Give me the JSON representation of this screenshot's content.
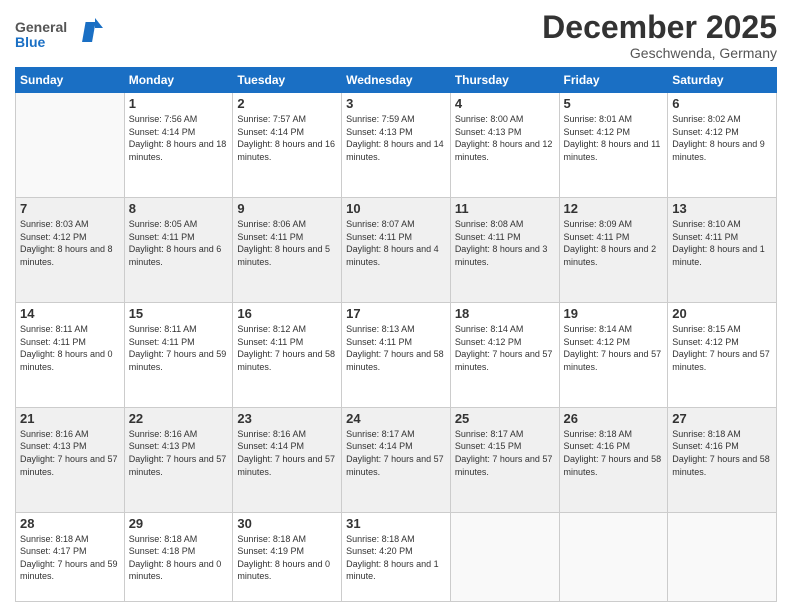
{
  "logo": {
    "text_general": "General",
    "text_blue": "Blue"
  },
  "title": "December 2025",
  "location": "Geschwenda, Germany",
  "weekdays": [
    "Sunday",
    "Monday",
    "Tuesday",
    "Wednesday",
    "Thursday",
    "Friday",
    "Saturday"
  ],
  "weeks": [
    [
      {
        "day": "",
        "sunrise": "",
        "sunset": "",
        "daylight": ""
      },
      {
        "day": "1",
        "sunrise": "Sunrise: 7:56 AM",
        "sunset": "Sunset: 4:14 PM",
        "daylight": "Daylight: 8 hours and 18 minutes."
      },
      {
        "day": "2",
        "sunrise": "Sunrise: 7:57 AM",
        "sunset": "Sunset: 4:14 PM",
        "daylight": "Daylight: 8 hours and 16 minutes."
      },
      {
        "day": "3",
        "sunrise": "Sunrise: 7:59 AM",
        "sunset": "Sunset: 4:13 PM",
        "daylight": "Daylight: 8 hours and 14 minutes."
      },
      {
        "day": "4",
        "sunrise": "Sunrise: 8:00 AM",
        "sunset": "Sunset: 4:13 PM",
        "daylight": "Daylight: 8 hours and 12 minutes."
      },
      {
        "day": "5",
        "sunrise": "Sunrise: 8:01 AM",
        "sunset": "Sunset: 4:12 PM",
        "daylight": "Daylight: 8 hours and 11 minutes."
      },
      {
        "day": "6",
        "sunrise": "Sunrise: 8:02 AM",
        "sunset": "Sunset: 4:12 PM",
        "daylight": "Daylight: 8 hours and 9 minutes."
      }
    ],
    [
      {
        "day": "7",
        "sunrise": "Sunrise: 8:03 AM",
        "sunset": "Sunset: 4:12 PM",
        "daylight": "Daylight: 8 hours and 8 minutes."
      },
      {
        "day": "8",
        "sunrise": "Sunrise: 8:05 AM",
        "sunset": "Sunset: 4:11 PM",
        "daylight": "Daylight: 8 hours and 6 minutes."
      },
      {
        "day": "9",
        "sunrise": "Sunrise: 8:06 AM",
        "sunset": "Sunset: 4:11 PM",
        "daylight": "Daylight: 8 hours and 5 minutes."
      },
      {
        "day": "10",
        "sunrise": "Sunrise: 8:07 AM",
        "sunset": "Sunset: 4:11 PM",
        "daylight": "Daylight: 8 hours and 4 minutes."
      },
      {
        "day": "11",
        "sunrise": "Sunrise: 8:08 AM",
        "sunset": "Sunset: 4:11 PM",
        "daylight": "Daylight: 8 hours and 3 minutes."
      },
      {
        "day": "12",
        "sunrise": "Sunrise: 8:09 AM",
        "sunset": "Sunset: 4:11 PM",
        "daylight": "Daylight: 8 hours and 2 minutes."
      },
      {
        "day": "13",
        "sunrise": "Sunrise: 8:10 AM",
        "sunset": "Sunset: 4:11 PM",
        "daylight": "Daylight: 8 hours and 1 minute."
      }
    ],
    [
      {
        "day": "14",
        "sunrise": "Sunrise: 8:11 AM",
        "sunset": "Sunset: 4:11 PM",
        "daylight": "Daylight: 8 hours and 0 minutes."
      },
      {
        "day": "15",
        "sunrise": "Sunrise: 8:11 AM",
        "sunset": "Sunset: 4:11 PM",
        "daylight": "Daylight: 7 hours and 59 minutes."
      },
      {
        "day": "16",
        "sunrise": "Sunrise: 8:12 AM",
        "sunset": "Sunset: 4:11 PM",
        "daylight": "Daylight: 7 hours and 58 minutes."
      },
      {
        "day": "17",
        "sunrise": "Sunrise: 8:13 AM",
        "sunset": "Sunset: 4:11 PM",
        "daylight": "Daylight: 7 hours and 58 minutes."
      },
      {
        "day": "18",
        "sunrise": "Sunrise: 8:14 AM",
        "sunset": "Sunset: 4:12 PM",
        "daylight": "Daylight: 7 hours and 57 minutes."
      },
      {
        "day": "19",
        "sunrise": "Sunrise: 8:14 AM",
        "sunset": "Sunset: 4:12 PM",
        "daylight": "Daylight: 7 hours and 57 minutes."
      },
      {
        "day": "20",
        "sunrise": "Sunrise: 8:15 AM",
        "sunset": "Sunset: 4:12 PM",
        "daylight": "Daylight: 7 hours and 57 minutes."
      }
    ],
    [
      {
        "day": "21",
        "sunrise": "Sunrise: 8:16 AM",
        "sunset": "Sunset: 4:13 PM",
        "daylight": "Daylight: 7 hours and 57 minutes."
      },
      {
        "day": "22",
        "sunrise": "Sunrise: 8:16 AM",
        "sunset": "Sunset: 4:13 PM",
        "daylight": "Daylight: 7 hours and 57 minutes."
      },
      {
        "day": "23",
        "sunrise": "Sunrise: 8:16 AM",
        "sunset": "Sunset: 4:14 PM",
        "daylight": "Daylight: 7 hours and 57 minutes."
      },
      {
        "day": "24",
        "sunrise": "Sunrise: 8:17 AM",
        "sunset": "Sunset: 4:14 PM",
        "daylight": "Daylight: 7 hours and 57 minutes."
      },
      {
        "day": "25",
        "sunrise": "Sunrise: 8:17 AM",
        "sunset": "Sunset: 4:15 PM",
        "daylight": "Daylight: 7 hours and 57 minutes."
      },
      {
        "day": "26",
        "sunrise": "Sunrise: 8:18 AM",
        "sunset": "Sunset: 4:16 PM",
        "daylight": "Daylight: 7 hours and 58 minutes."
      },
      {
        "day": "27",
        "sunrise": "Sunrise: 8:18 AM",
        "sunset": "Sunset: 4:16 PM",
        "daylight": "Daylight: 7 hours and 58 minutes."
      }
    ],
    [
      {
        "day": "28",
        "sunrise": "Sunrise: 8:18 AM",
        "sunset": "Sunset: 4:17 PM",
        "daylight": "Daylight: 7 hours and 59 minutes."
      },
      {
        "day": "29",
        "sunrise": "Sunrise: 8:18 AM",
        "sunset": "Sunset: 4:18 PM",
        "daylight": "Daylight: 8 hours and 0 minutes."
      },
      {
        "day": "30",
        "sunrise": "Sunrise: 8:18 AM",
        "sunset": "Sunset: 4:19 PM",
        "daylight": "Daylight: 8 hours and 0 minutes."
      },
      {
        "day": "31",
        "sunrise": "Sunrise: 8:18 AM",
        "sunset": "Sunset: 4:20 PM",
        "daylight": "Daylight: 8 hours and 1 minute."
      },
      {
        "day": "",
        "sunrise": "",
        "sunset": "",
        "daylight": ""
      },
      {
        "day": "",
        "sunrise": "",
        "sunset": "",
        "daylight": ""
      },
      {
        "day": "",
        "sunrise": "",
        "sunset": "",
        "daylight": ""
      }
    ]
  ]
}
